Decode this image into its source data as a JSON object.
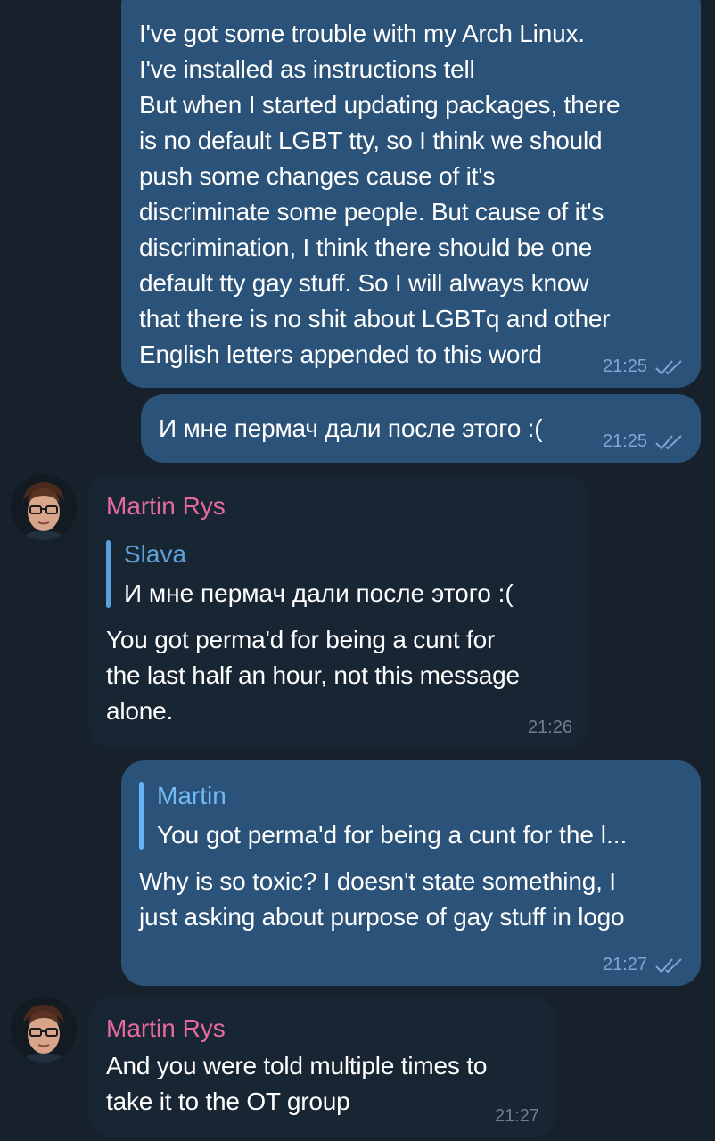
{
  "colors": {
    "background": "#17212b",
    "outgoing_bubble": "#2b5278",
    "incoming_bubble": "#182533",
    "sender_name": "#e56aa2",
    "quote_accent": "#6ab3f3",
    "timestamp_out": "#7da8d3",
    "timestamp_in": "#6d7f8f"
  },
  "messages": [
    {
      "text": "I've got some trouble with my Arch Linux.\nI've installed as instructions tell\nBut when I started updating packages, there\nis no default LGBT tty, so I think we should\npush some changes cause of it's\ndiscriminate some people. But cause of it's\ndiscrimination, I think there should be one\ndefault tty gay stuff. So I will always know\nthat there is no shit about LGBTq and other\nEnglish letters appended to this word",
      "time": "21:25",
      "status_icon": "double-check-icon"
    },
    {
      "text": "И мне пермач дали после этого :(",
      "time": "21:25",
      "status_icon": "double-check-icon"
    },
    {
      "sender": "Martin Rys",
      "reply_name": "Slava",
      "reply_text": "И мне пермач дали после этого :(",
      "text": "You got perma'd for being a cunt for\nthe last half an hour, not this message\nalone.",
      "time": "21:26",
      "avatar_icon": "user-avatar-icon"
    },
    {
      "reply_name": "Martin",
      "reply_text": "You got perma'd for being a cunt for the l...",
      "text": "Why is so toxic? I doesn't state something, I\njust asking about purpose of gay stuff in logo",
      "time": "21:27",
      "status_icon": "double-check-icon"
    },
    {
      "sender": "Martin Rys",
      "text": "And you were told multiple times to\ntake it to the OT group",
      "time": "21:27",
      "avatar_icon": "user-avatar-icon"
    }
  ]
}
